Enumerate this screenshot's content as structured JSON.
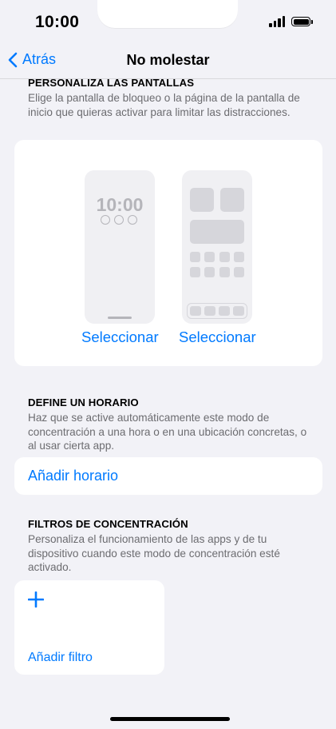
{
  "status": {
    "time": "10:00"
  },
  "nav": {
    "back_label": "Atrás",
    "title": "No molestar"
  },
  "screens": {
    "header": "PERSONALIZA LAS PANTALLAS",
    "description": "Elige la pantalla de bloqueo o la página de la pantalla de inicio que quieras activar para limitar las distracciones.",
    "lock_preview_time": "10:00",
    "select_lock": "Seleccionar",
    "select_home": "Seleccionar"
  },
  "schedule": {
    "header": "DEFINE UN HORARIO",
    "description": "Haz que se active automáticamente este modo de concentración a una hora o en una ubicación concretas, o al usar cierta app.",
    "add_label": "Añadir horario"
  },
  "filters": {
    "header": "FILTROS DE CONCENTRACIÓN",
    "description": "Personaliza el funcionamiento de las apps y de tu dispositivo cuando este modo de concentración esté activado.",
    "add_label": "Añadir filtro"
  },
  "colors": {
    "accent": "#007aff",
    "background": "#f2f2f7"
  }
}
